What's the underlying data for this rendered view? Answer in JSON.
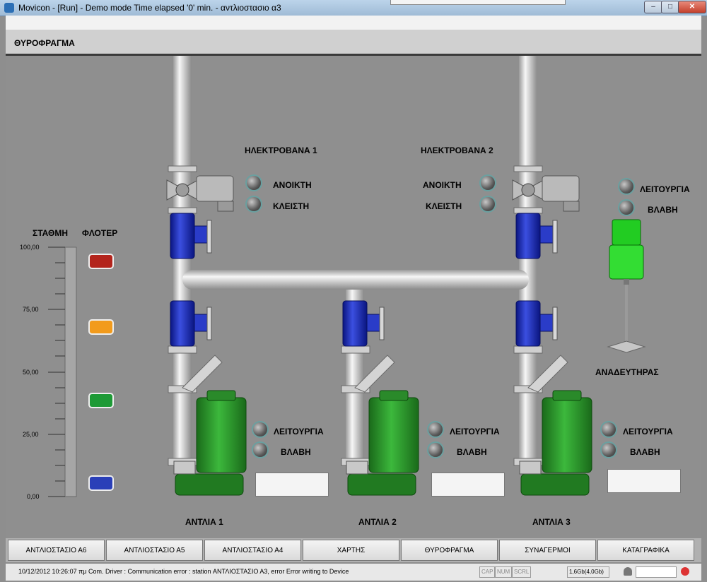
{
  "window": {
    "title": "Movicon - [Run] - Demo mode Time elapsed '0' min. - αντλιοστασιο α3",
    "min": "–",
    "max": "□",
    "close": "✕"
  },
  "header": {
    "title": "ΘΥΡΟΦΡΑΓΜΑ"
  },
  "level": {
    "station_label": "ΣΤΑΘΜΗ",
    "float_label": "ΦΛΟΤΕΡ",
    "ticks": [
      "100,00",
      "75,00",
      "50,00",
      "25,00",
      "0,00"
    ],
    "float_colors": [
      "#b3241c",
      "#f29b1c",
      "#1e9a36",
      "#2a3fb8"
    ]
  },
  "valve1": {
    "title": "ΗΛΕΚΤΡΟΒΑΝΑ 1",
    "open": "ΑΝΟΙΚΤΗ",
    "closed": "ΚΛΕΙΣΤΗ"
  },
  "valve2": {
    "title": "ΗΛΕΚΤΡΟΒΑΝΑ 2",
    "open": "ΑΝΟΙΚΤΗ",
    "closed": "ΚΛΕΙΣΤΗ"
  },
  "mixer": {
    "run": "ΛΕΙΤΟΥΡΓΙΑ",
    "fault": "ΒΛΑΒΗ",
    "name": "ΑΝΑΔΕΥΤΗΡΑΣ"
  },
  "pumps": [
    {
      "name": "ΑΝΤΛΙΑ 1",
      "run": "ΛΕΙΤΟΥΡΓΙΑ",
      "fault": "ΒΛΑΒΗ"
    },
    {
      "name": "ΑΝΤΛΙΑ 2",
      "run": "ΛΕΙΤΟΥΡΓΙΑ",
      "fault": "ΒΛΑΒΗ"
    },
    {
      "name": "ΑΝΤΛΙΑ 3",
      "run": "ΛΕΙΤΟΥΡΓΙΑ",
      "fault": "ΒΛΑΒΗ"
    }
  ],
  "nav": [
    "ΑΝΤΛΙΟΣΤΑΣΙΟ Α6",
    "ΑΝΤΛΙΟΣΤΑΣΙΟ Α5",
    "ΑΝΤΛΙΟΣΤΑΣΙΟ Α4",
    "ΧΑΡΤΗΣ",
    "ΘΥΡΟΦΡΑΓΜΑ",
    "ΣΥΝΑΓΕΡΜΟΙ",
    "ΚΑΤΑΓΡΑΦΙΚΑ"
  ],
  "status": {
    "message": "10/12/2012 10:26:07 πμ Com. Driver : Communication error : station ΑΝΤΛΙΟΣΤΑΣΙΟ Α3, error Error writing to Device",
    "cap": "CAP",
    "num": "NUM",
    "scrl": "SCRL",
    "memory": "1,6Gb(4,0Gb)"
  },
  "colors": {
    "pump": "#2f9a2f",
    "valve": "#1f2fb0",
    "pipe": "#d8d8d8",
    "mixer": "#33dd33"
  }
}
